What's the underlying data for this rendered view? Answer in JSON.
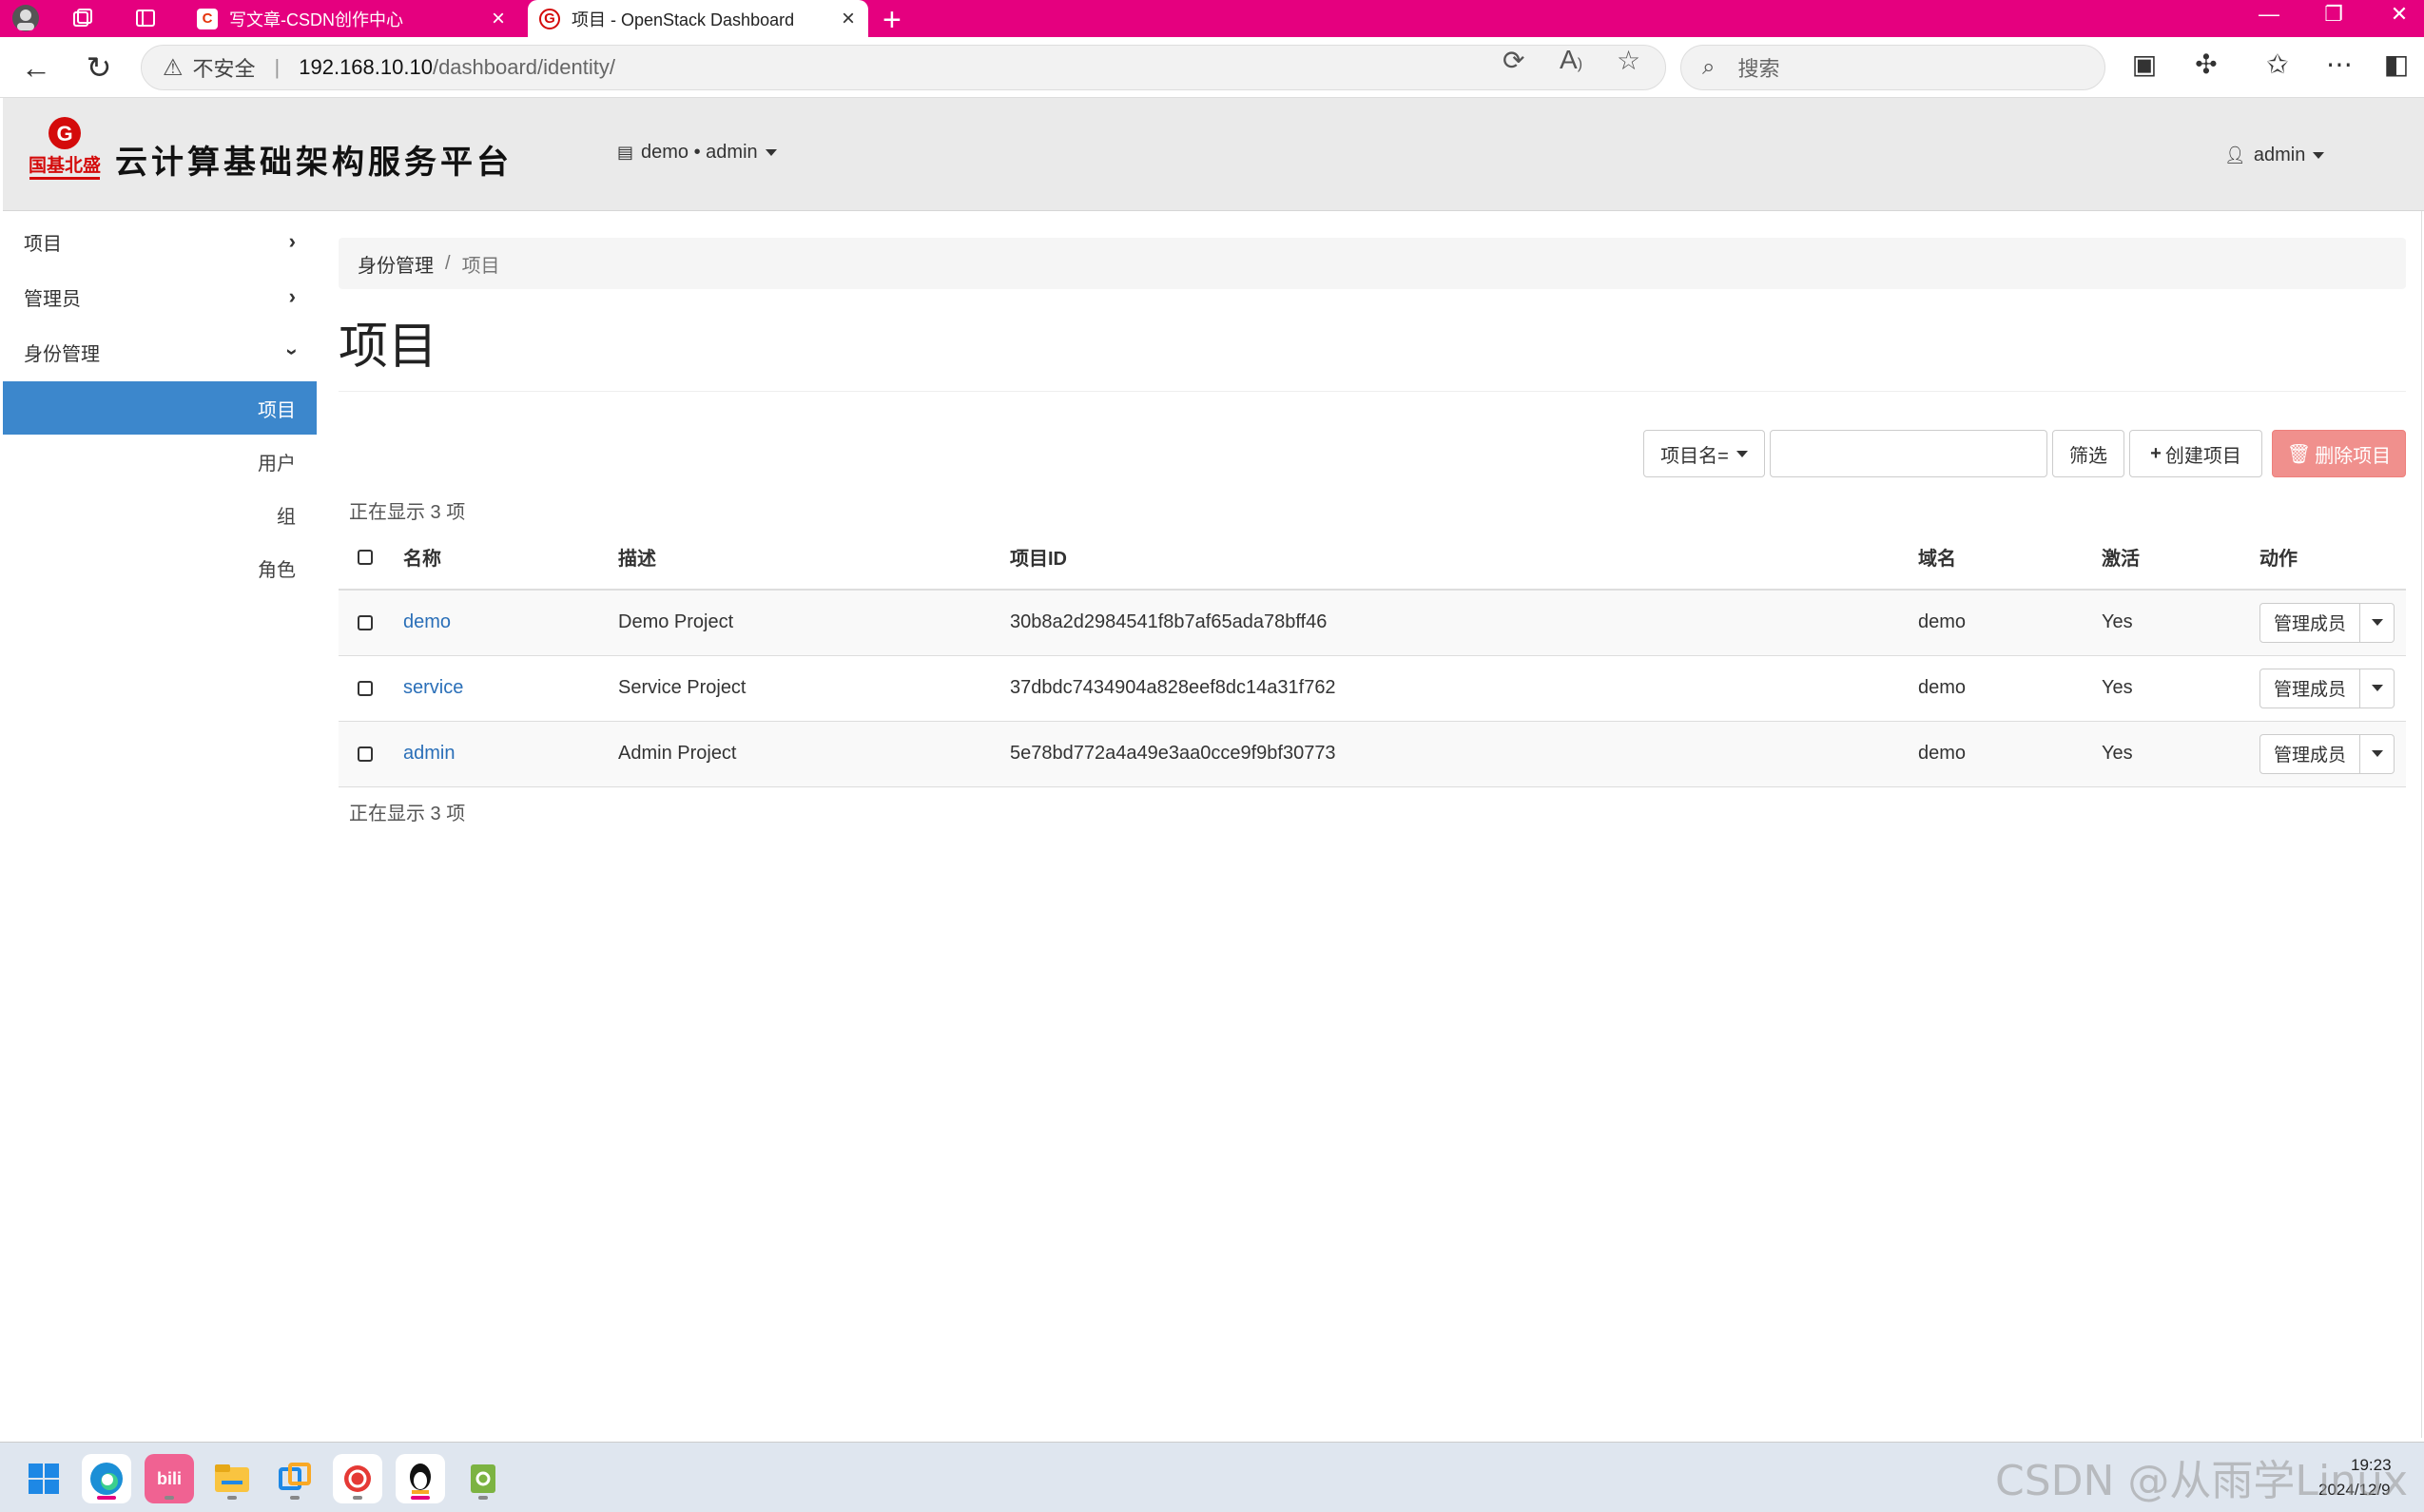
{
  "browser": {
    "tabs": [
      {
        "title": "写文章-CSDN创作中心",
        "favicon": "csdn-icon"
      },
      {
        "title": "项目 - OpenStack Dashboard",
        "favicon": "openstack-logo-icon",
        "active": true
      }
    ],
    "address": {
      "security_label": "不安全",
      "host": "192.168.10.10",
      "path": "/dashboard/identity/"
    },
    "search_placeholder": "搜索"
  },
  "header": {
    "brand": "云计算基础架构服务平台",
    "logo_text": "国基北盛",
    "project_selector": "demo • admin",
    "user_menu": "admin"
  },
  "sidebar": {
    "items": [
      {
        "label": "项目"
      },
      {
        "label": "管理员"
      },
      {
        "label": "身份管理"
      }
    ],
    "sub_items": [
      {
        "label": "项目",
        "active": true
      },
      {
        "label": "用户"
      },
      {
        "label": "组"
      },
      {
        "label": "角色"
      }
    ]
  },
  "main": {
    "breadcrumb": {
      "parent": "身份管理",
      "separator": "/",
      "current": "项目"
    },
    "title": "项目",
    "filter": {
      "field_label": "项目名=",
      "input_value": "",
      "filter_button": "筛选",
      "create_button": "创建项目",
      "delete_button": "删除项目"
    },
    "count_top": "正在显示 3 项",
    "count_bottom": "正在显示 3 项",
    "table": {
      "columns": [
        "名称",
        "描述",
        "项目ID",
        "域名",
        "激活",
        "动作"
      ],
      "rows": [
        {
          "name": "demo",
          "description": "Demo Project",
          "id": "30b8a2d2984541f8b7af65ada78bff46",
          "domain": "demo",
          "enabled": "Yes",
          "action": "管理成员"
        },
        {
          "name": "service",
          "description": "Service Project",
          "id": "37dbdc7434904a828eef8dc14a31f762",
          "domain": "demo",
          "enabled": "Yes",
          "action": "管理成员"
        },
        {
          "name": "admin",
          "description": "Admin Project",
          "id": "5e78bd772a4a49e3aa0cce9f9bf30773",
          "domain": "demo",
          "enabled": "Yes",
          "action": "管理成员"
        }
      ]
    }
  },
  "taskbar": {
    "time": "19:23",
    "date": "2024/12/9"
  },
  "watermark": "CSDN @从雨学Linux",
  "colors": {
    "tabstrip": "#e5007f",
    "active_nav": "#3c87cc",
    "link": "#2a6fb8",
    "danger": "#f0908d"
  }
}
